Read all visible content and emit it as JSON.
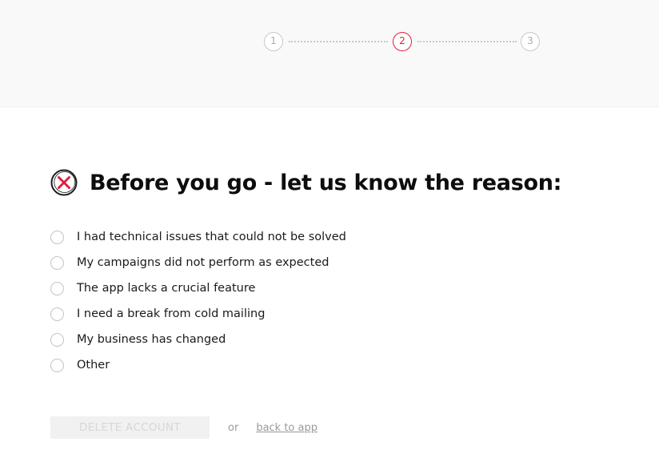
{
  "stepper": {
    "steps": [
      "1",
      "2",
      "3"
    ],
    "active_step": 2,
    "active_color": "#e0203d"
  },
  "header": {
    "icon": "close-circle-icon",
    "title": "Before you go - let us know the reason:"
  },
  "reasons": [
    {
      "label": "I had technical issues that could not be solved",
      "selected": false
    },
    {
      "label": "My campaigns did not perform as expected",
      "selected": false
    },
    {
      "label": "The app lacks a crucial feature",
      "selected": false
    },
    {
      "label": "I need a break from cold mailing",
      "selected": false
    },
    {
      "label": "My business has changed",
      "selected": false
    },
    {
      "label": "Other",
      "selected": false
    }
  ],
  "footer": {
    "delete_label": "DELETE ACCOUNT",
    "delete_disabled": true,
    "or_text": "or",
    "back_label": "back to app"
  }
}
